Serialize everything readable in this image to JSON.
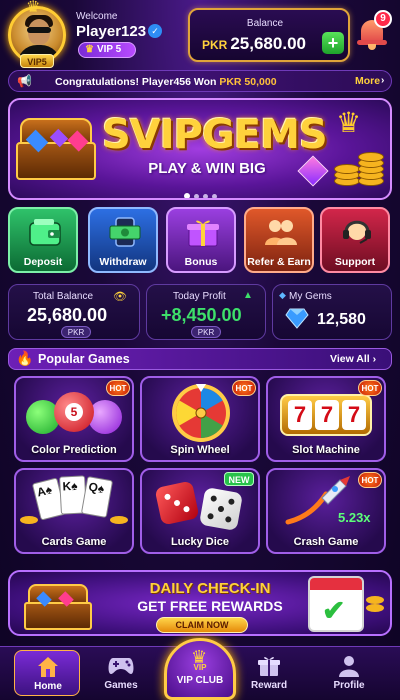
{
  "header": {
    "avatar_badge": "VIP5",
    "welcome": "Welcome",
    "username": "Player123",
    "vip_level": "VIP 5",
    "balance_label": "Balance",
    "balance_currency": "PKR",
    "balance_value": "25,680.00",
    "notification_count": "9"
  },
  "ticker": {
    "text_prefix": "Congratulations! Player456 Won ",
    "text_amount": "PKR 50,000",
    "more_label": "More"
  },
  "banner": {
    "title": "SVIPGEMS",
    "subtitle": "PLAY & WIN BIG",
    "slide_count": 4,
    "active_slide": 1
  },
  "quick_actions": [
    {
      "label": "Deposit",
      "icon": "wallet-icon"
    },
    {
      "label": "Withdraw",
      "icon": "cash-phone-icon"
    },
    {
      "label": "Bonus",
      "icon": "gift-icon"
    },
    {
      "label": "Refer & Earn",
      "icon": "users-icon"
    },
    {
      "label": "Support",
      "icon": "headset-icon"
    }
  ],
  "stats": {
    "total_balance_label": "Total Balance",
    "total_balance_value": "25,680.00",
    "total_balance_currency": "PKR",
    "today_profit_label": "Today Profit",
    "today_profit_value": "+8,450.00",
    "today_profit_currency": "PKR",
    "gems_label": "My Gems",
    "gems_value": "12,580"
  },
  "popular_games": {
    "title": "Popular Games",
    "view_all": "View All",
    "games": [
      {
        "label": "Color Prediction",
        "badge": "HOT"
      },
      {
        "label": "Spin Wheel",
        "badge": "HOT"
      },
      {
        "label": "Slot Machine",
        "badge": "HOT"
      },
      {
        "label": "Cards Game",
        "badge": ""
      },
      {
        "label": "Lucky Dice",
        "badge": "NEW"
      },
      {
        "label": "Crash Game",
        "badge": "HOT",
        "multiplier": "5.23x"
      }
    ]
  },
  "checkin": {
    "title": "DAILY CHECK-IN",
    "subtitle": "GET FREE REWARDS",
    "button": "CLAIM NOW"
  },
  "nav": {
    "home": "Home",
    "games": "Games",
    "vip_small": "VIP",
    "vip_club": "VIP CLUB",
    "reward": "Reward",
    "profile": "Profile"
  },
  "colors": {
    "accent_gold": "#ffd23c",
    "profit_green": "#3ee06a",
    "background": "#1a0838"
  }
}
